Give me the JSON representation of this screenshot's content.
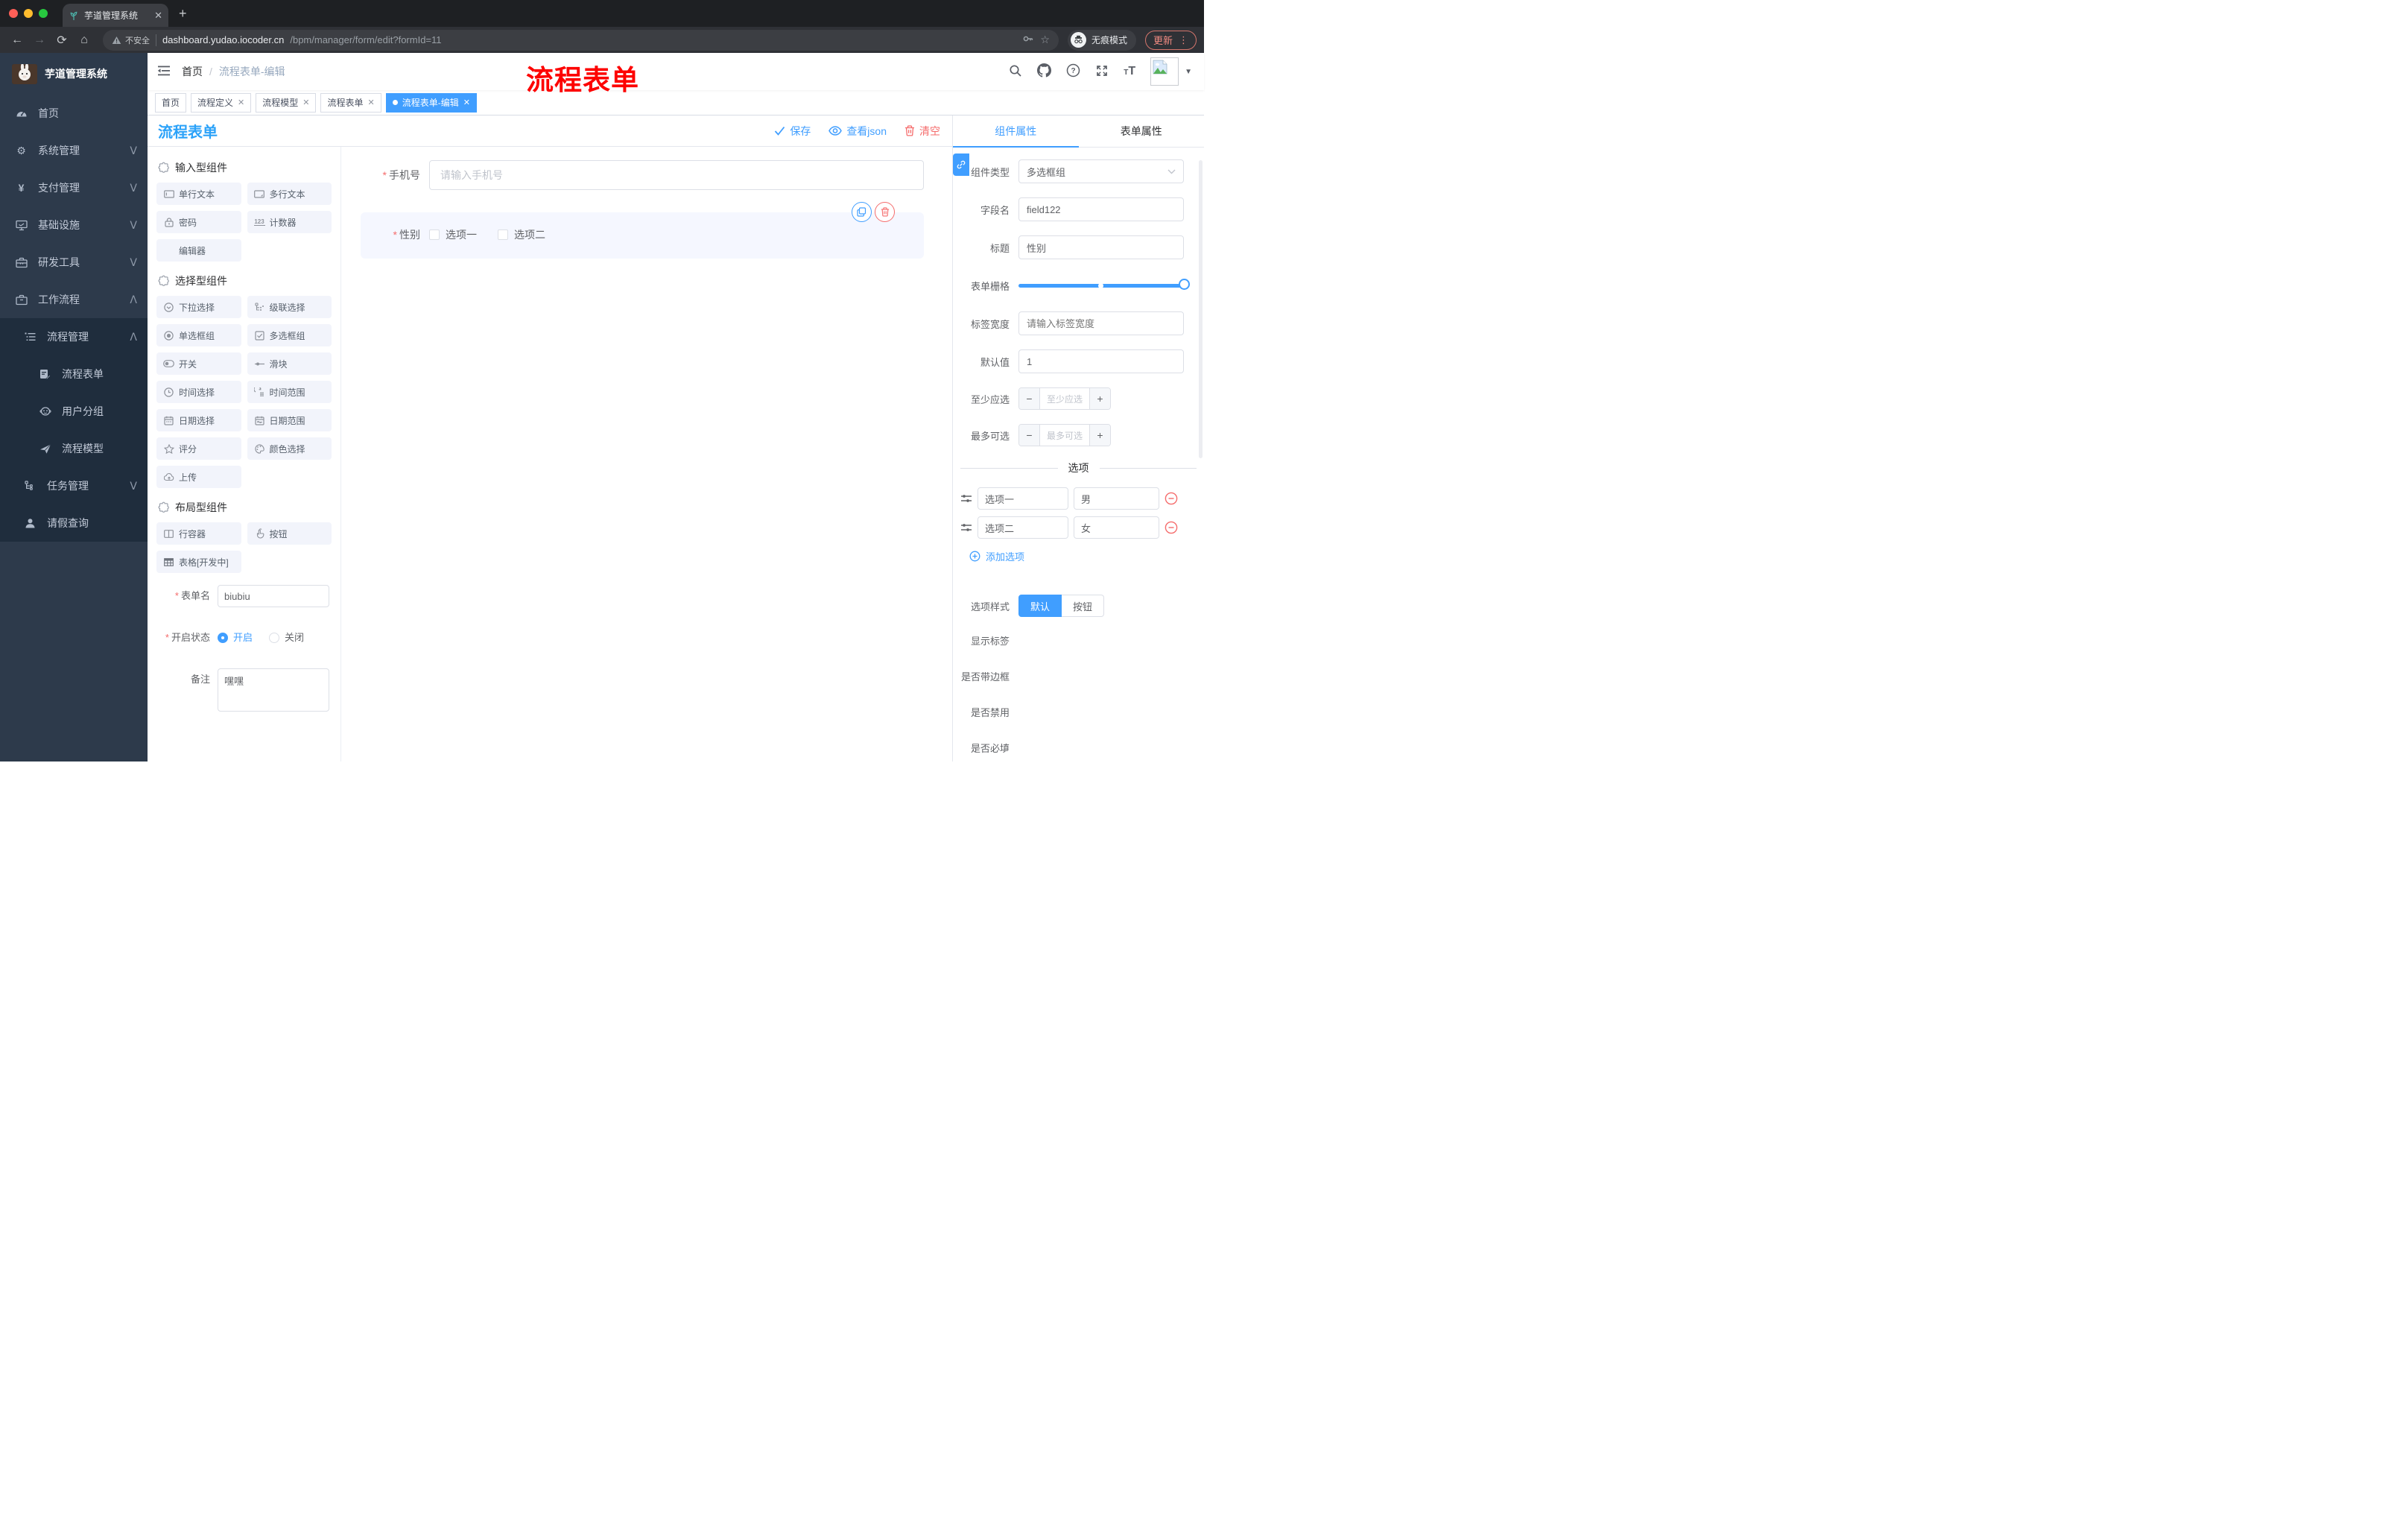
{
  "colors": {
    "accent": "#409eff",
    "danger": "#f56c6c",
    "sidebar_bg": "#2d3a4b",
    "submenu_bg": "#1f2d3d",
    "annotation": "#fd0100",
    "tag_active_bg": "#409eff",
    "designer_title": "#2ba2f9"
  },
  "browser": {
    "tab_title": "芋道管理系统",
    "security_label": "不安全",
    "url_host": "dashboard.yudao.iocoder.cn",
    "url_path": "/bpm/manager/form/edit?formId=11",
    "incognito_label": "无痕模式",
    "update_label": "更新"
  },
  "annotation": {
    "text": "流程表单"
  },
  "sidebar": {
    "app_title": "芋道管理系统",
    "items": [
      {
        "label": "首页",
        "icon": "dashboard-icon"
      },
      {
        "label": "系统管理",
        "icon": "gear-icon"
      },
      {
        "label": "支付管理",
        "icon": "yen-icon"
      },
      {
        "label": "基础设施",
        "icon": "monitor-icon"
      },
      {
        "label": "研发工具",
        "icon": "toolbox-icon"
      },
      {
        "label": "工作流程",
        "icon": "briefcase-icon"
      }
    ],
    "sub": [
      {
        "label": "流程管理",
        "children": [
          {
            "label": "流程表单",
            "icon": "form-doc-icon"
          },
          {
            "label": "用户分组",
            "icon": "robot-icon"
          },
          {
            "label": "流程模型",
            "icon": "paper-plane-icon"
          }
        ]
      },
      {
        "label": "任务管理"
      },
      {
        "label": "请假查询"
      }
    ]
  },
  "navbar": {
    "breadcrumb_home": "首页",
    "breadcrumb_sep": "/",
    "breadcrumb_current": "流程表单-编辑"
  },
  "tags_view": {
    "tags": [
      {
        "label": "首页"
      },
      {
        "label": "流程定义"
      },
      {
        "label": "流程模型"
      },
      {
        "label": "流程表单"
      },
      {
        "label": "流程表单-编辑"
      }
    ]
  },
  "designer": {
    "title": "流程表单",
    "actions": {
      "save": "保存",
      "view_json": "查看json",
      "clear": "清空"
    },
    "palette": {
      "sections": [
        {
          "title": "输入型组件",
          "items": [
            {
              "label": "单行文本",
              "icon": "input-icon"
            },
            {
              "label": "多行文本",
              "icon": "textarea-icon"
            },
            {
              "label": "密码",
              "icon": "lock-icon"
            },
            {
              "label": "计数器",
              "icon": "counter-icon"
            },
            {
              "label": "编辑器",
              "icon": "editor-icon"
            }
          ]
        },
        {
          "title": "选择型组件",
          "items": [
            {
              "label": "下拉选择",
              "icon": "select-icon"
            },
            {
              "label": "级联选择",
              "icon": "cascader-icon"
            },
            {
              "label": "单选框组",
              "icon": "radio-icon"
            },
            {
              "label": "多选框组",
              "icon": "checkbox-icon"
            },
            {
              "label": "开关",
              "icon": "switch-icon"
            },
            {
              "label": "滑块",
              "icon": "slider-icon"
            },
            {
              "label": "时间选择",
              "icon": "time-icon"
            },
            {
              "label": "时间范围",
              "icon": "time-range-icon"
            },
            {
              "label": "日期选择",
              "icon": "date-icon"
            },
            {
              "label": "日期范围",
              "icon": "date-range-icon"
            },
            {
              "label": "评分",
              "icon": "star-icon"
            },
            {
              "label": "颜色选择",
              "icon": "palette-icon"
            },
            {
              "label": "上传",
              "icon": "upload-icon"
            }
          ]
        },
        {
          "title": "布局型组件",
          "items": [
            {
              "label": "行容器",
              "icon": "row-icon"
            },
            {
              "label": "按钮",
              "icon": "hand-icon"
            },
            {
              "label": "表格[开发中]",
              "icon": "table-icon"
            }
          ]
        }
      ]
    },
    "meta": {
      "form_name": {
        "label": "表单名",
        "value": "biubiu"
      },
      "status": {
        "label": "开启状态",
        "on_label": "开启",
        "off_label": "关闭",
        "selected": "开启"
      },
      "remark": {
        "label": "备注",
        "value": "嘿嘿"
      }
    },
    "canvas": {
      "phone": {
        "label": "手机号",
        "placeholder": "请输入手机号"
      },
      "gender": {
        "label": "性别",
        "options": [
          {
            "label": "选项一"
          },
          {
            "label": "选项二"
          }
        ]
      }
    },
    "props": {
      "tabs": [
        "组件属性",
        "表单属性"
      ],
      "active_tab": "组件属性",
      "component_type": {
        "label": "组件类型",
        "value": "多选框组"
      },
      "field_name": {
        "label": "字段名",
        "value": "field122"
      },
      "title_field": {
        "label": "标题",
        "value": "性别"
      },
      "grid": {
        "label": "表单栅格"
      },
      "label_width": {
        "label": "标签宽度",
        "placeholder": "请输入标签宽度"
      },
      "default_value": {
        "label": "默认值",
        "value": "1"
      },
      "min_select": {
        "label": "至少应选",
        "placeholder": "至少应选"
      },
      "max_select": {
        "label": "最多可选",
        "placeholder": "最多可选"
      },
      "options": {
        "title": "选项",
        "rows": [
          {
            "label": "选项一",
            "value": "男"
          },
          {
            "label": "选项二",
            "value": "女"
          }
        ],
        "add_label": "添加选项"
      },
      "option_style": {
        "label": "选项样式",
        "options": [
          "默认",
          "按钮"
        ],
        "selected": "默认"
      },
      "toggles": [
        {
          "label": "显示标签",
          "on": true
        },
        {
          "label": "是否带边框",
          "on": false
        },
        {
          "label": "是否禁用",
          "on": false
        },
        {
          "label": "是否必填",
          "on": true
        }
      ]
    }
  }
}
